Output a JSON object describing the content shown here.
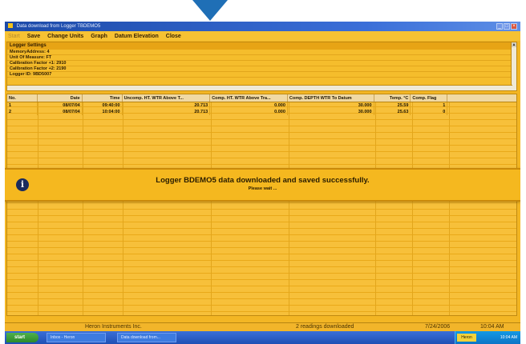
{
  "window": {
    "title": "Data download from Logger TBDEMO5",
    "minimize": "_",
    "maximize": "□",
    "close": "×"
  },
  "menu": {
    "start": "Start",
    "save": "Save",
    "change_units": "Change Units",
    "graph": "Graph",
    "datum_elevation": "Datum Elevation",
    "close": "Close"
  },
  "settings": {
    "header": "Logger Settings",
    "lines": [
      "MemoryAddress: 4",
      "Unit Of Measure: FT",
      "Calibration Factor +1: 2910",
      "Calibration Factor +2: 2190",
      "Logger ID: 9BD5007"
    ]
  },
  "table": {
    "columns": [
      "No.",
      "Date",
      "Time",
      "Uncomp. HT. WTR Above T...",
      "Comp. HT. WTR Above Tra...",
      "Comp. DEPTH WTR To Datum",
      "Temp. °C",
      "Comp. Flag",
      ""
    ],
    "rows": [
      [
        "1",
        "08/07/04",
        "09:40:00",
        "20.713",
        "0.000",
        "30.000",
        "25.59",
        "1"
      ],
      [
        "2",
        "08/07/04",
        "10:04:00",
        "20.713",
        "0.000",
        "30.000",
        "25.63",
        "0"
      ]
    ]
  },
  "banner": {
    "message": "Logger BDEMO5 data downloaded and saved successfully.",
    "sub": "Please wait ..."
  },
  "status": {
    "company": "Heron Instruments Inc.",
    "records": "2 readings downloaded",
    "date": "7/24/2006",
    "time": "10:04 AM"
  },
  "taskbar": {
    "start": "start",
    "buttons": [
      "Inbox - Heron",
      "Data download from..."
    ],
    "tray_chip": "Heron",
    "clock": "10:04 AM"
  }
}
